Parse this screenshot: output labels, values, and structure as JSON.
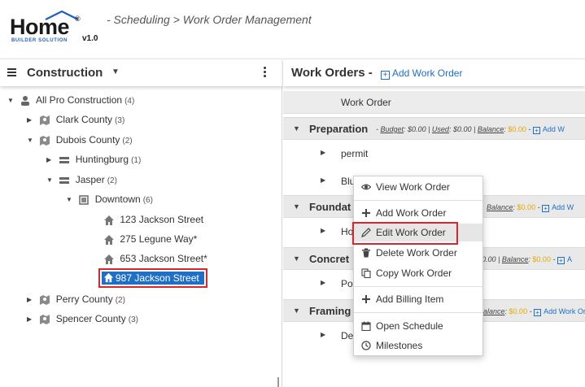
{
  "header": {
    "logo_text": "Home",
    "logo_reg": "®",
    "logo_sub": "BUILDER SOLUTION",
    "logo_version": "v1.0",
    "breadcrumb": "- Scheduling > Work Order Management"
  },
  "left": {
    "title": "Construction",
    "caret": "▼",
    "tree": [
      {
        "label": "All Pro Construction",
        "count": "(4)",
        "arrow": "▼",
        "icon": "person-icon"
      },
      {
        "label": "Clark County",
        "count": "(3)",
        "arrow": "▶",
        "icon": "county-icon"
      },
      {
        "label": "Dubois County",
        "count": "(2)",
        "arrow": "▼",
        "icon": "county-icon"
      },
      {
        "label": "Huntingburg",
        "count": "(1)",
        "arrow": "▶",
        "icon": "city-icon"
      },
      {
        "label": "Jasper",
        "count": "(2)",
        "arrow": "▼",
        "icon": "city-icon"
      },
      {
        "label": "Downtown",
        "count": "(6)",
        "arrow": "▼",
        "icon": "subdivision-icon"
      },
      {
        "label": "123 Jackson Street",
        "count": "",
        "arrow": "",
        "icon": "house-icon"
      },
      {
        "label": "275 Legune Way*",
        "count": "",
        "arrow": "",
        "icon": "house-icon"
      },
      {
        "label": "653 Jackson Street*",
        "count": "",
        "arrow": "",
        "icon": "house-icon"
      },
      {
        "label": "987 Jackson Street",
        "count": "",
        "arrow": "",
        "icon": "house-icon"
      },
      {
        "label": "Perry County",
        "count": "(2)",
        "arrow": "▶",
        "icon": "county-icon"
      },
      {
        "label": "Spencer County",
        "count": "(3)",
        "arrow": "▶",
        "icon": "county-icon"
      }
    ]
  },
  "right": {
    "title": "Work Orders -",
    "add_label": "Add Work Order",
    "column_header": "Work Order",
    "groups": [
      {
        "name": "Preparation",
        "budget_label": "Budget",
        "budget": "$0.00",
        "used_label": "Used",
        "used": "$0.00",
        "balance_label": "Balance",
        "balance": "$0.00",
        "add": "Add W"
      },
      {
        "name": "Foundat",
        "balance_label": "Balance",
        "balance": "$0.00",
        "add": "Add W"
      },
      {
        "name": "Concret",
        "used_tail": "0.00 |",
        "balance_label": "Balance",
        "balance": "$0.00",
        "add": "A"
      },
      {
        "name": "Framing",
        "balance_label": "alance",
        "balance": "$0.00",
        "add": "Add Work Or"
      }
    ],
    "items": [
      {
        "name": "permit"
      },
      {
        "name": "Blu"
      },
      {
        "name": "Ho"
      },
      {
        "name": "Po"
      },
      {
        "name": "De"
      }
    ]
  },
  "context_menu": {
    "items": [
      {
        "label": "View Work Order",
        "icon": "eye-icon"
      },
      {
        "label": "Add Work Order",
        "icon": "plus-icon"
      },
      {
        "label": "Edit Work Order",
        "icon": "pencil-icon"
      },
      {
        "label": "Delete Work Order",
        "icon": "trash-icon"
      },
      {
        "label": "Copy Work Order",
        "icon": "copy-icon"
      },
      {
        "label": "Add Billing Item",
        "icon": "plus-icon"
      },
      {
        "label": "Open Schedule",
        "icon": "calendar-icon"
      },
      {
        "label": "Milestones",
        "icon": "clock-icon"
      }
    ]
  },
  "colors": {
    "accent": "#1f6fc4",
    "highlight": "#d9262c",
    "balance": "#e6a700"
  }
}
